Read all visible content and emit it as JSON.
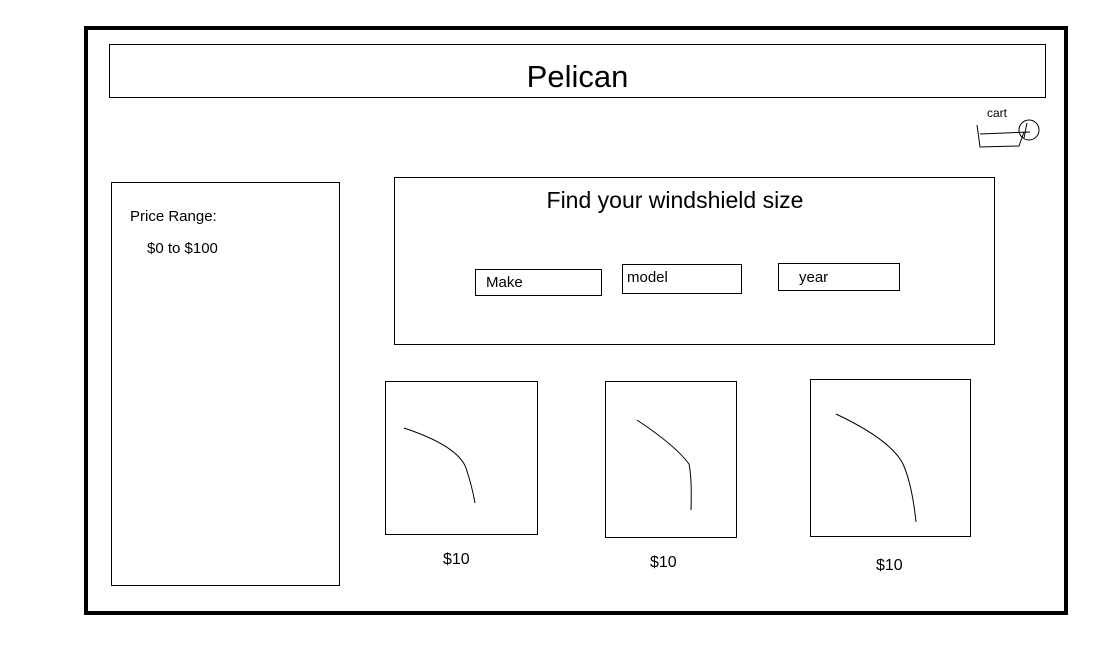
{
  "header": {
    "title": "Pelican"
  },
  "cart": {
    "label": "cart",
    "icon": "cart-icon"
  },
  "sidebar": {
    "price_range_label": "Price Range:",
    "price_range_value": "$0 to $100"
  },
  "finder": {
    "title": "Find your windshield size",
    "make_placeholder": "Make",
    "model_placeholder": "model",
    "year_placeholder": "year"
  },
  "products": [
    {
      "price": "$10",
      "image": "windshield-image"
    },
    {
      "price": "$10",
      "image": "windshield-image"
    },
    {
      "price": "$10",
      "image": "windshield-image"
    }
  ]
}
